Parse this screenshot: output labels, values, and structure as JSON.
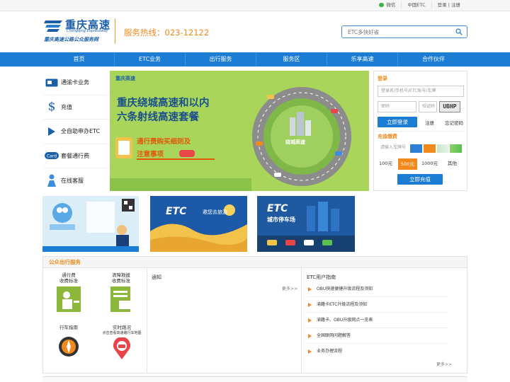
{
  "topbar": {
    "wechat": "微信",
    "china_etc": "中国ETC",
    "login": "登录",
    "sep": "|",
    "register": "注册"
  },
  "header": {
    "logo_title": "重庆高速",
    "logo_en": "Chongqing Expressway",
    "logo_sub": "重庆高速公路公众服务网",
    "hotline": "服务热线：023-12122",
    "search_placeholder": "ETC多快好省"
  },
  "nav": [
    "首页",
    "ETC业务",
    "出行服务",
    "服务区",
    "乐享高速",
    "合作伙伴"
  ],
  "leftmenu": [
    {
      "label": "通渝卡业务",
      "icon": "card-icon"
    },
    {
      "label": "充值",
      "icon": "dollar-icon"
    },
    {
      "label": "全自助申办ETC",
      "icon": "play-icon"
    },
    {
      "label": "套餐通行费",
      "icon": "card-badge-icon"
    },
    {
      "label": "在线客服",
      "icon": "person-icon"
    }
  ],
  "banner": {
    "logo": "重庆高速",
    "line1": "重庆绕城高速和以内",
    "line2": "六条射线高速套餐",
    "sub1": "通行费购买细则及",
    "sub2": "注意事项",
    "road_label": "绕城高速"
  },
  "login_panel": {
    "title": "登录",
    "account_placeholder": "登录名/手机号/ETC账号/车牌",
    "password_placeholder": "密码",
    "captcha_placeholder": "验证码",
    "captcha_text": "UBHP",
    "login_button": "立即登录",
    "register": "注册",
    "forgot": "忘记密码",
    "recharge_title": "充值缴费",
    "plate_placeholder": "请输入车牌号",
    "amounts": [
      "100元",
      "500元",
      "1000元",
      "其他"
    ],
    "selected_amount": "500元",
    "recharge_button": "立即充值",
    "colors": {
      "accent": "#1a7cd3",
      "orange": "#f08a1c"
    }
  },
  "tiles": [
    {
      "caption": ""
    },
    {
      "etc": "ETC",
      "caption": "邀您去旅游"
    },
    {
      "etc": "ETC",
      "caption": "城市停车场"
    }
  ],
  "services": {
    "title": "公众出行服务",
    "items": [
      {
        "line1": "通行费",
        "line2": "收费标准"
      },
      {
        "line1": "清障救援",
        "line2": "收费标准"
      },
      {
        "line1": "行车指南",
        "line2": ""
      },
      {
        "line1": "实时路况",
        "line2": "点击查看高速路行车地图"
      }
    ],
    "notice_title": "通知",
    "more": "更多>>",
    "guide_title": "ETC用户指南",
    "guides": [
      "OBU快速便捷升级流程及须知",
      "渝籍卡ETC升级流程及须知",
      "渝籍卡、OBU升级网点一览表",
      "全国联网问题解答",
      "业务办理流程"
    ]
  }
}
